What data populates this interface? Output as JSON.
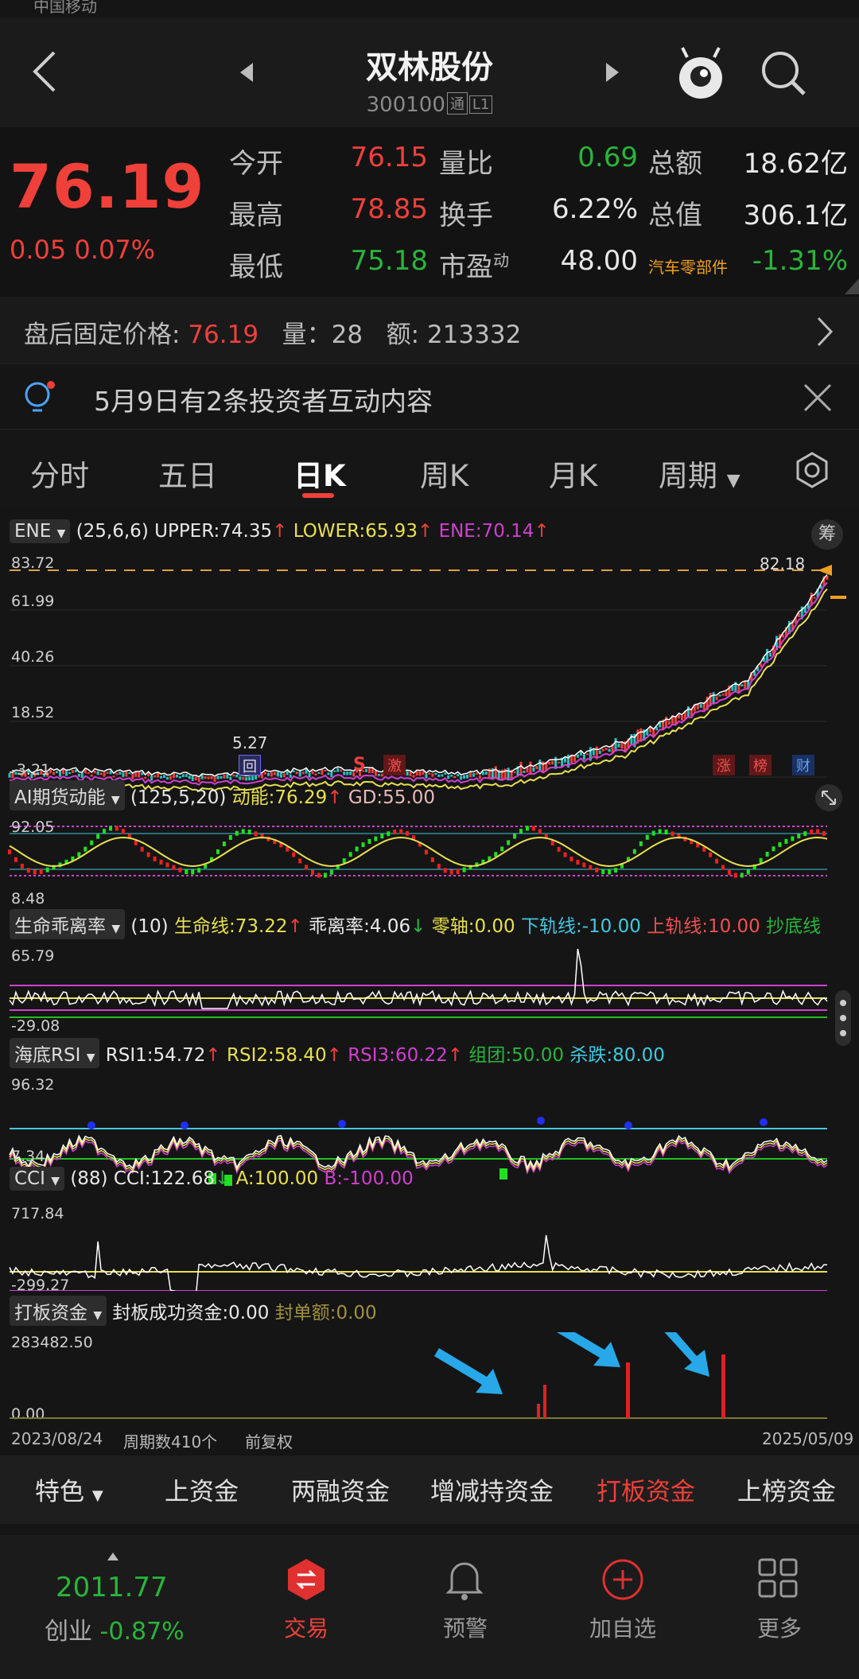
{
  "statusbar": {
    "carrier": "中国移动"
  },
  "header": {
    "title": "双林股份",
    "code": "300100",
    "tag1": "通",
    "tag2": "L1"
  },
  "quote": {
    "price": "76.19",
    "change": "0.05",
    "change_pct": "0.07%",
    "rows": [
      {
        "l1": "今开",
        "v1": "76.15",
        "l2": "量比",
        "v2": "0.69",
        "l3": "总额",
        "v3": "18.62亿"
      },
      {
        "l1": "最高",
        "v1": "78.85",
        "l2": "换手",
        "v2": "6.22%",
        "l3": "总值",
        "v3": "306.1亿"
      },
      {
        "l1": "最低",
        "v1": "75.18",
        "l2": "市盈",
        "l2sup": "动",
        "v2": "48.00",
        "l3": "汽车零部件",
        "v3": "-1.31%"
      }
    ]
  },
  "afterhours": {
    "label": "盘后固定价格:",
    "price": "76.19",
    "vol_label": "量：",
    "vol": "28",
    "amt_label": "额:",
    "amt": "213332"
  },
  "notice": {
    "text": "5月9日有2条投资者互动内容"
  },
  "tabs": [
    "分时",
    "五日",
    "日K",
    "周K",
    "月K",
    "周期"
  ],
  "colors": {
    "up": "#f0403a",
    "down": "#29b53b",
    "accent_orange": "#f0a020",
    "magenta": "#d040d0",
    "yellow": "#e8e050",
    "cyan": "#40c8e0"
  },
  "icons": [
    "back-arrow-icon",
    "prev-icon",
    "next-icon",
    "mascot-icon",
    "search-icon",
    "chevron-right-icon",
    "bulb-icon",
    "close-icon",
    "settings-icon",
    "chip-icon",
    "expand-icon",
    "dots-icon",
    "trade-icon",
    "bell-icon",
    "plus-icon",
    "grid-icon"
  ],
  "ene": {
    "name": "ENE",
    "params": "(25,6,6)",
    "upper_label": "UPPER:",
    "upper": "74.35",
    "lower_label": "LOWER:",
    "lower": "65.93",
    "ene_label": "ENE:",
    "ene": "70.14",
    "y": [
      "83.72",
      "61.99",
      "40.26",
      "18.52",
      "-3.21"
    ],
    "high_mark": "82.18",
    "low_mark": "5.27",
    "badges": [
      "回",
      "S",
      "激",
      "涨",
      "榜",
      "财"
    ],
    "chip": "筹"
  },
  "ai": {
    "name": "AI期货动能",
    "params": "(125,5,20)",
    "k1": "动能:",
    "v1": "76.29",
    "k2": "GD:",
    "v2": "55.00",
    "y": [
      "92.05",
      "8.48"
    ]
  },
  "life": {
    "name": "生命乖离率",
    "params": "(10)",
    "k1": "生命线:",
    "v1": "73.22",
    "k2": "乖离率:",
    "v2": "4.06",
    "k3": "零轴:",
    "v3": "0.00",
    "k4": "下轨线:",
    "v4": "-10.00",
    "k5": "上轨线:",
    "v5": "10.00",
    "k6": "抄底线",
    "y": [
      "65.79",
      "-29.08"
    ]
  },
  "rsi": {
    "name": "海底RSI",
    "k1": "RSI1:",
    "v1": "54.72",
    "k2": "RSI2:",
    "v2": "58.40",
    "k3": "RSI3:",
    "v3": "60.22",
    "k4": "组团:",
    "v4": "50.00",
    "k5": "杀跌:",
    "v5": "80.00",
    "y": [
      "96.32",
      "7.34"
    ]
  },
  "cci": {
    "name": "CCI",
    "params": "(88)",
    "k1": "CCI:",
    "v1": "122.68",
    "k2": "A:",
    "v2": "100.00",
    "k3": "B:",
    "v3": "-100.00",
    "y": [
      "717.84",
      "-299.27"
    ]
  },
  "daban": {
    "name": "打板资金",
    "k1": "封板成功资金:",
    "v1": "0.00",
    "k2": "封单额:",
    "v2": "0.00",
    "y": [
      "283482.50",
      "0.00"
    ]
  },
  "axis": {
    "start": "2023/08/24",
    "periods": "周期数410个",
    "adj": "前复权",
    "end": "2025/05/09"
  },
  "subtabs": [
    "特色",
    "上资金",
    "两融资金",
    "增减持资金",
    "打板资金",
    "上榜资金"
  ],
  "navbar": {
    "index_value": "2011.77",
    "index_name": "创业",
    "index_chg": "-0.87%",
    "items": [
      "交易",
      "预警",
      "加自选",
      "更多"
    ]
  }
}
